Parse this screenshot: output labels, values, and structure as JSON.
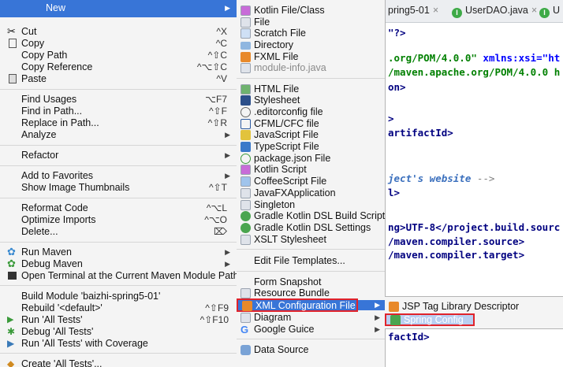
{
  "context_menu": {
    "new_label": "New",
    "items": [
      {
        "label": "Cut",
        "shortcut": "^X",
        "icon": "scissors-icon"
      },
      {
        "label": "Copy",
        "shortcut": "^C",
        "icon": "copy-icon"
      },
      {
        "label": "Copy Path",
        "shortcut": "^⇧C"
      },
      {
        "label": "Copy Reference",
        "shortcut": "^⌥⇧C"
      },
      {
        "label": "Paste",
        "shortcut": "^V",
        "icon": "clipboard-icon"
      },
      {
        "label": "Find Usages",
        "shortcut": "⌥F7"
      },
      {
        "label": "Find in Path...",
        "shortcut": "^⇧F"
      },
      {
        "label": "Replace in Path...",
        "shortcut": "^⇧R"
      },
      {
        "label": "Analyze",
        "shortcut": ""
      },
      {
        "label": "Refactor",
        "shortcut": ""
      },
      {
        "label": "Add to Favorites",
        "shortcut": ""
      },
      {
        "label": "Show Image Thumbnails",
        "shortcut": "^⇧T"
      },
      {
        "label": "Reformat Code",
        "shortcut": "^⌥L"
      },
      {
        "label": "Optimize Imports",
        "shortcut": "^⌥O"
      },
      {
        "label": "Delete...",
        "shortcut": "⌦"
      },
      {
        "label": "Run Maven",
        "shortcut": ""
      },
      {
        "label": "Debug Maven",
        "shortcut": ""
      },
      {
        "label": "Open Terminal at the Current Maven Module Path",
        "shortcut": ""
      },
      {
        "label": "Build Module 'baizhi-spring5-01'",
        "shortcut": ""
      },
      {
        "label": "Rebuild '<default>'",
        "shortcut": "^⇧F9"
      },
      {
        "label": "Run 'All Tests'",
        "shortcut": "^⇧F10"
      },
      {
        "label": "Debug 'All Tests'",
        "shortcut": ""
      },
      {
        "label": "Run 'All Tests' with Coverage",
        "shortcut": ""
      },
      {
        "label": "Create 'All Tests'...",
        "shortcut": ""
      }
    ]
  },
  "new_submenu": {
    "items": [
      {
        "label": "Kotlin File/Class"
      },
      {
        "label": "File"
      },
      {
        "label": "Scratch File"
      },
      {
        "label": "Directory"
      },
      {
        "label": "FXML File"
      },
      {
        "label": "module-info.java"
      },
      {
        "label": "HTML File"
      },
      {
        "label": "Stylesheet"
      },
      {
        "label": ".editorconfig file"
      },
      {
        "label": "CFML/CFC file"
      },
      {
        "label": "JavaScript File"
      },
      {
        "label": "TypeScript File"
      },
      {
        "label": "package.json File"
      },
      {
        "label": "Kotlin Script"
      },
      {
        "label": "CoffeeScript File"
      },
      {
        "label": "JavaFXApplication"
      },
      {
        "label": "Singleton"
      },
      {
        "label": "Gradle Kotlin DSL Build Script"
      },
      {
        "label": "Gradle Kotlin DSL Settings"
      },
      {
        "label": "XSLT Stylesheet"
      },
      {
        "label": "Edit File Templates..."
      },
      {
        "label": "Form Snapshot"
      },
      {
        "label": "Resource Bundle"
      },
      {
        "label": "XML Configuration File"
      },
      {
        "label": "Diagram"
      },
      {
        "label": "Google Guice"
      },
      {
        "label": "Data Source"
      }
    ]
  },
  "xml_submenu": {
    "items": [
      {
        "label": "JSP Tag Library Descriptor"
      },
      {
        "label": "Spring Config"
      }
    ]
  },
  "editor": {
    "tabs": [
      {
        "label": "pring5-01",
        "close": "×"
      },
      {
        "label": "UserDAO.java",
        "close": "×"
      },
      {
        "label": "U"
      }
    ],
    "lines": [
      "\"?>",
      ".org/POM/4.0.0\"",
      " xmlns:xsi=\"ht",
      "/maven.apache.org/POM/4.0.0 h",
      "on>",
      ">",
      "artifactId>",
      "ject's website",
      " -->",
      "l>",
      "ng>UTF-8</",
      "project.build.sourc",
      "/maven.compiler.source>",
      "/maven.compiler.target>",
      "factId>"
    ]
  },
  "colors": {
    "menu_bg": "#f4f4f4",
    "selection": "#3875d7",
    "highlight_box": "#e0232b",
    "xml_tag": "#000080",
    "xml_string": "#008000"
  }
}
